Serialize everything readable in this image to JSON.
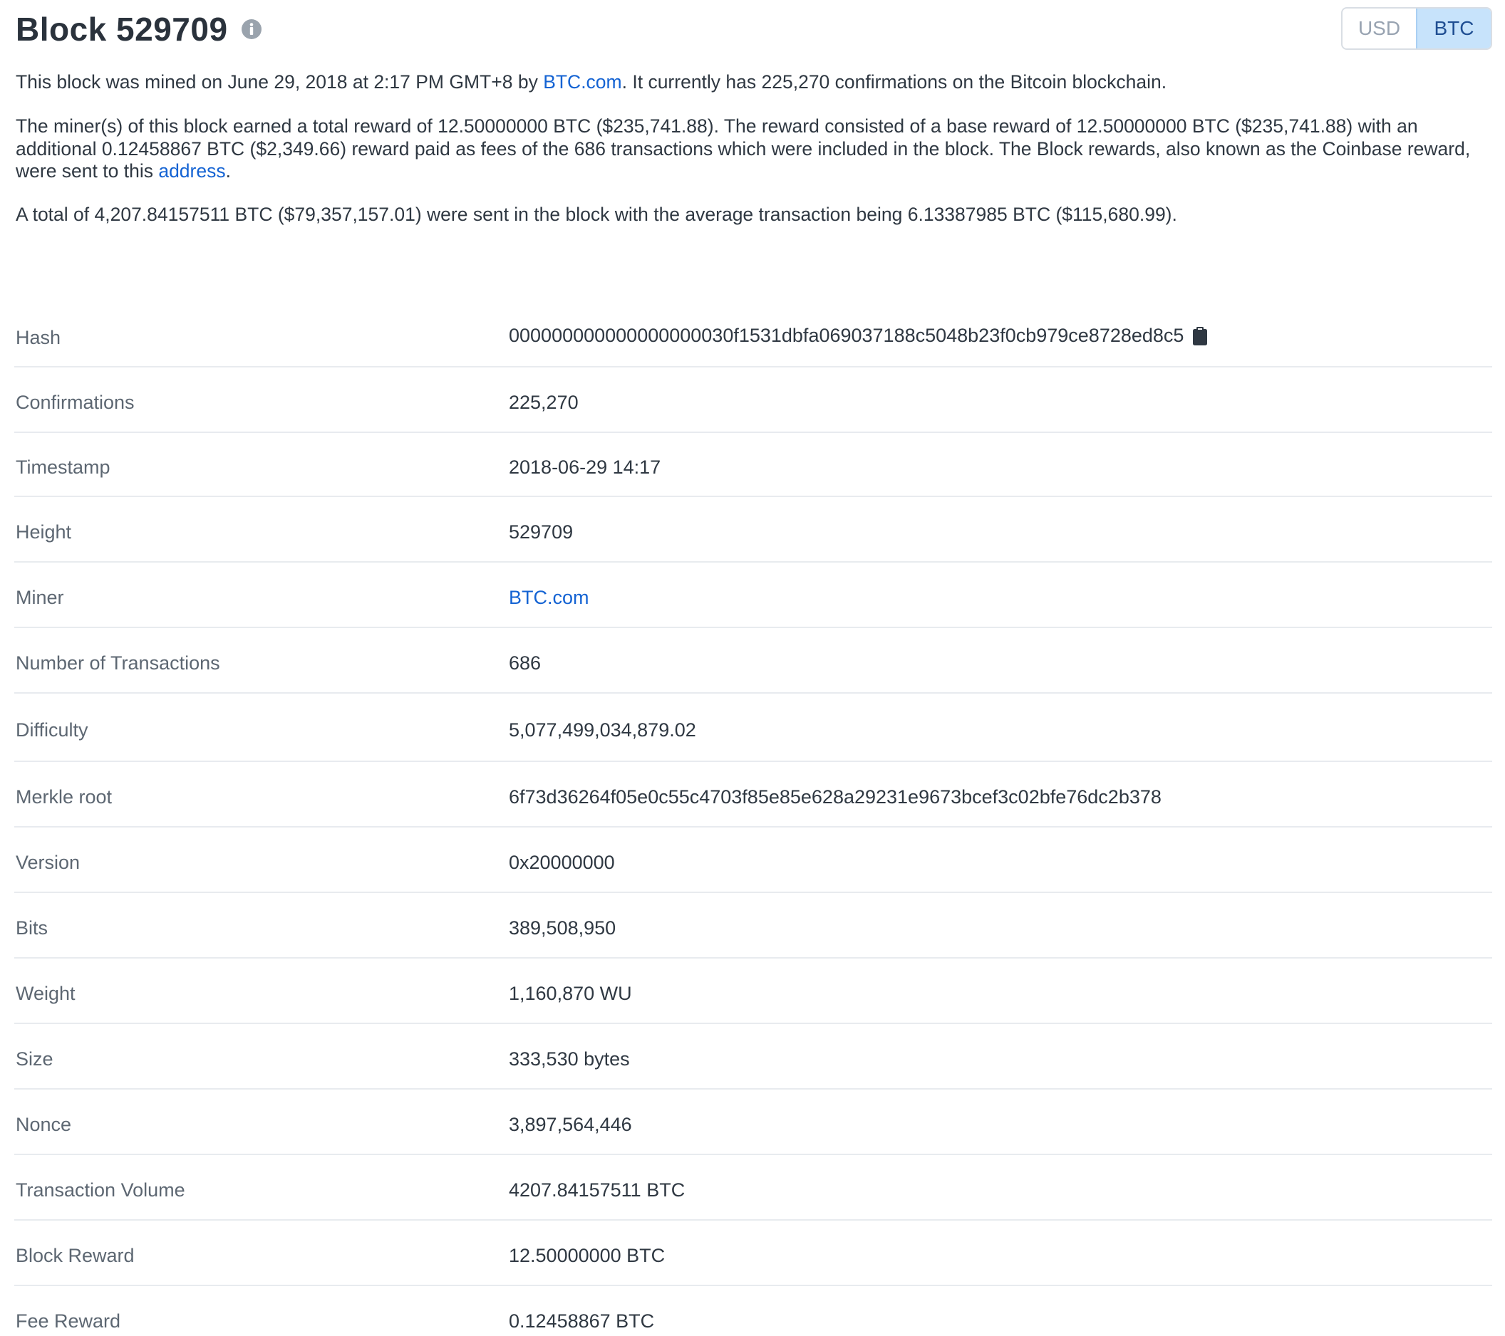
{
  "header": {
    "title": "Block 529709",
    "currency_options": [
      "USD",
      "BTC"
    ],
    "selected_currency": "BTC"
  },
  "description": {
    "p1_before": "This block was mined on June 29, 2018 at 2:17 PM GMT+8 by ",
    "p1_link": "BTC.com",
    "p1_after": ". It currently has 225,270 confirmations on the Bitcoin blockchain.",
    "p2_before": "The miner(s) of this block earned a total reward of 12.50000000 BTC ($235,741.88). The reward consisted of a base reward of 12.50000000 BTC ($235,741.88) with an additional 0.12458867 BTC ($2,349.66) reward paid as fees of the 686 transactions which were included in the block. The Block rewards, also known as the Coinbase reward, were sent to this ",
    "p2_link": "address",
    "p2_after": ".",
    "p3": "A total of 4,207.84157511 BTC ($79,357,157.01) were sent in the block with the average transaction being 6.13387985 BTC ($115,680.99)."
  },
  "details": [
    {
      "label": "Hash",
      "value": "000000000000000000030f1531dbfa069037188c5048b23f0cb979ce8728ed8c5"
    },
    {
      "label": "Confirmations",
      "value": "225,270"
    },
    {
      "label": "Timestamp",
      "value": "2018-06-29 14:17"
    },
    {
      "label": "Height",
      "value": "529709"
    },
    {
      "label": "Miner",
      "value": "BTC.com"
    },
    {
      "label": "Number of Transactions",
      "value": "686"
    },
    {
      "label": "Difficulty",
      "value": "5,077,499,034,879.02"
    },
    {
      "label": "Merkle root",
      "value": "6f73d36264f05e0c55c4703f85e85e628a29231e9673bcef3c02bfe76dc2b378"
    },
    {
      "label": "Version",
      "value": "0x20000000"
    },
    {
      "label": "Bits",
      "value": "389,508,950"
    },
    {
      "label": "Weight",
      "value": "1,160,870 WU"
    },
    {
      "label": "Size",
      "value": "333,530 bytes"
    },
    {
      "label": "Nonce",
      "value": "3,897,564,446"
    },
    {
      "label": "Transaction Volume",
      "value": "4207.84157511 BTC"
    },
    {
      "label": "Block Reward",
      "value": "12.50000000 BTC"
    },
    {
      "label": "Fee Reward",
      "value": "0.12458867 BTC"
    }
  ],
  "icons": {
    "info": "info-icon",
    "copy": "clipboard-icon"
  },
  "colors": {
    "link": "#1463d3",
    "active_toggle_bg": "#c7e3fb",
    "active_toggle_text": "#1f4e92"
  }
}
